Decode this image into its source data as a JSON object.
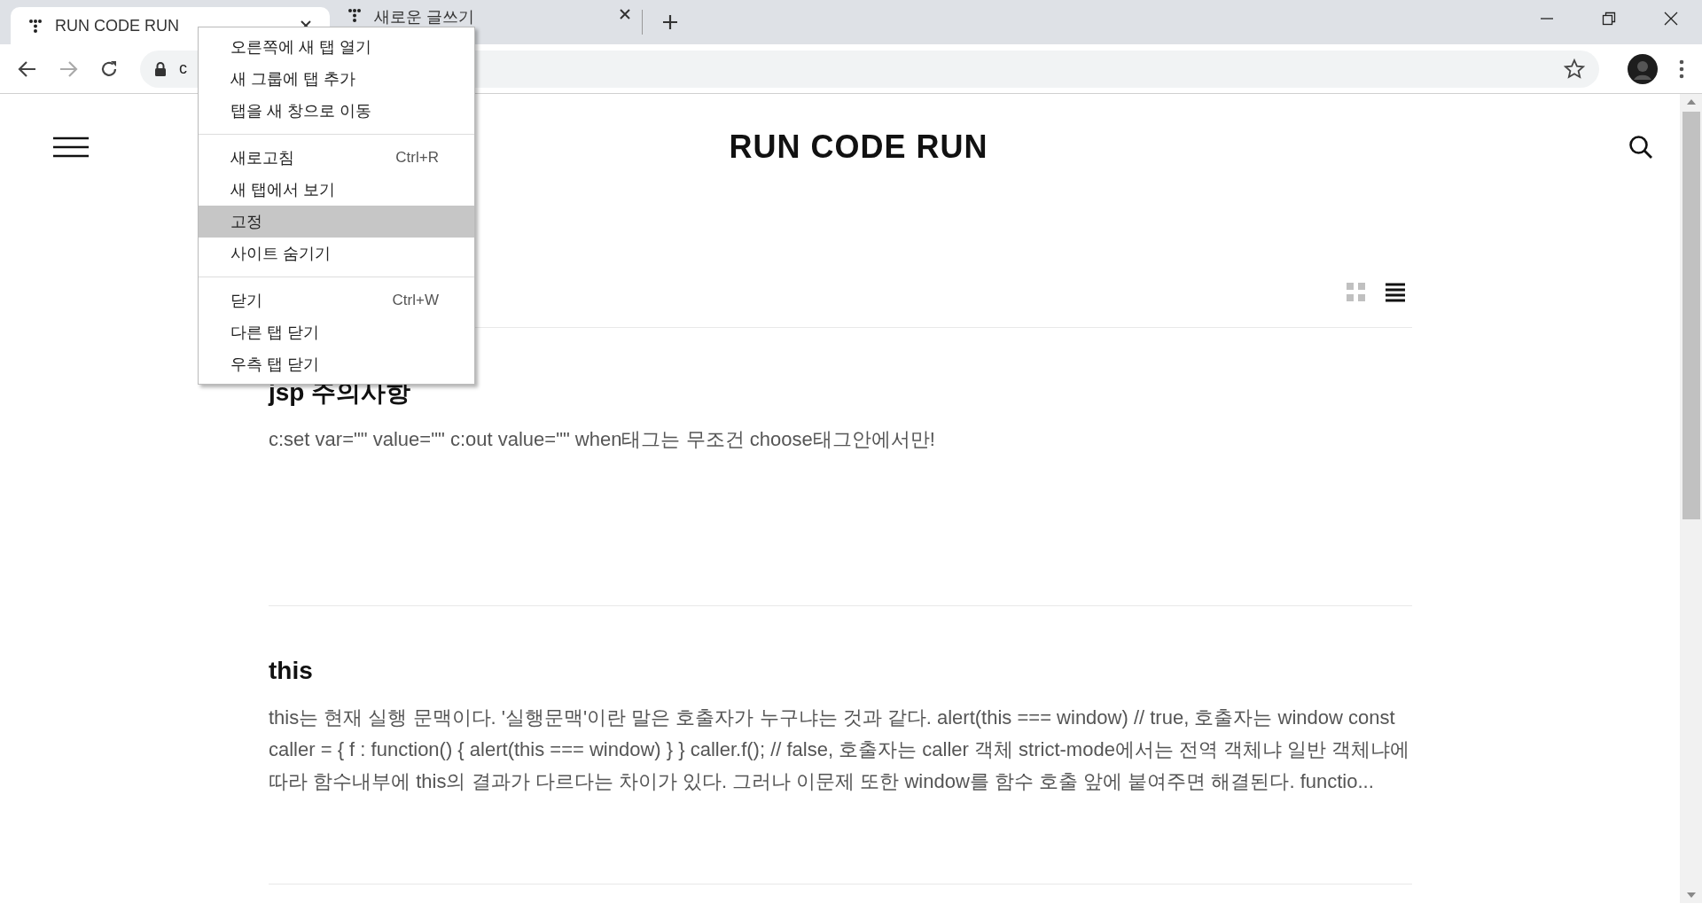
{
  "tabs": [
    {
      "title": "RUN CODE RUN",
      "selected": true
    },
    {
      "title": "새로운 글쓰기",
      "selected": false
    }
  ],
  "address_bar": {
    "text": "c"
  },
  "blog": {
    "title": "RUN CODE RUN",
    "view_modes": [
      {
        "kind": "grid",
        "selected": false
      },
      {
        "kind": "list",
        "selected": true
      }
    ],
    "posts": [
      {
        "title": "jsp 주의사항",
        "excerpt": "c:set var=\"\" value=\"\" c:out value=\"\" when태그는 무조건 choose태그안에서만!"
      },
      {
        "title": "this",
        "excerpt": "this는 현재 실행 문맥이다. '실행문맥'이란 말은 호출자가 누구냐는 것과 같다. alert(this === window) // true, 호출자는 window const caller = { f : function() { alert(this === window) } } caller.f(); // false, 호출자는 caller 객체 strict-mode에서는 전역 객체냐 일반 객체냐에 따라 함수내부에 this의 결과가 다르다는 차이가 있다. 그러나 이문제 또한 window를 함수 호출 앞에 붙여주면 해결된다. functio..."
      }
    ]
  },
  "context_menu": {
    "groups": [
      [
        {
          "label": "오른쪽에 새 탭 열기",
          "selected": false
        },
        {
          "label": "새 그룹에 탭 추가",
          "selected": false
        },
        {
          "label": "탭을 새 창으로 이동",
          "selected": false
        }
      ],
      [
        {
          "label": "새로고침",
          "shortcut": "Ctrl+R",
          "selected": false
        },
        {
          "label": "새 탭에서 보기",
          "selected": false
        },
        {
          "label": "고정",
          "selected": true
        },
        {
          "label": "사이트 숨기기",
          "selected": false
        }
      ],
      [
        {
          "label": "닫기",
          "shortcut": "Ctrl+W",
          "selected": false
        },
        {
          "label": "다른 탭 닫기",
          "selected": false
        },
        {
          "label": "우측 탭 닫기",
          "selected": false
        }
      ]
    ]
  }
}
